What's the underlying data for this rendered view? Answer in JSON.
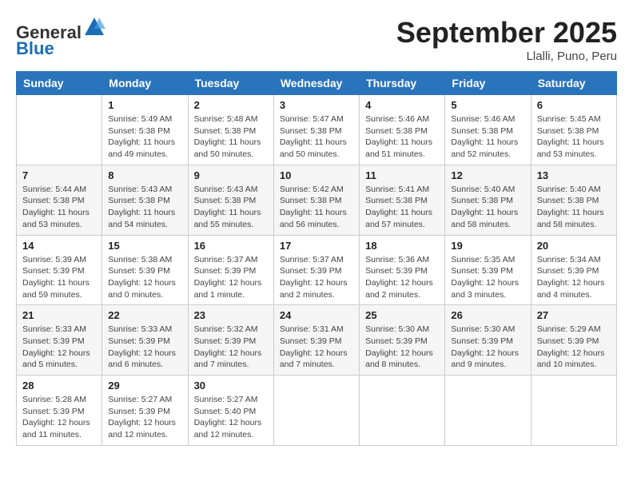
{
  "header": {
    "logo_general": "General",
    "logo_blue": "Blue",
    "month": "September 2025",
    "location": "Llalli, Puno, Peru"
  },
  "days_of_week": [
    "Sunday",
    "Monday",
    "Tuesday",
    "Wednesday",
    "Thursday",
    "Friday",
    "Saturday"
  ],
  "weeks": [
    [
      {
        "day": "",
        "sunrise": "",
        "sunset": "",
        "daylight": ""
      },
      {
        "day": "1",
        "sunrise": "Sunrise: 5:49 AM",
        "sunset": "Sunset: 5:38 PM",
        "daylight": "Daylight: 11 hours and 49 minutes."
      },
      {
        "day": "2",
        "sunrise": "Sunrise: 5:48 AM",
        "sunset": "Sunset: 5:38 PM",
        "daylight": "Daylight: 11 hours and 50 minutes."
      },
      {
        "day": "3",
        "sunrise": "Sunrise: 5:47 AM",
        "sunset": "Sunset: 5:38 PM",
        "daylight": "Daylight: 11 hours and 50 minutes."
      },
      {
        "day": "4",
        "sunrise": "Sunrise: 5:46 AM",
        "sunset": "Sunset: 5:38 PM",
        "daylight": "Daylight: 11 hours and 51 minutes."
      },
      {
        "day": "5",
        "sunrise": "Sunrise: 5:46 AM",
        "sunset": "Sunset: 5:38 PM",
        "daylight": "Daylight: 11 hours and 52 minutes."
      },
      {
        "day": "6",
        "sunrise": "Sunrise: 5:45 AM",
        "sunset": "Sunset: 5:38 PM",
        "daylight": "Daylight: 11 hours and 53 minutes."
      }
    ],
    [
      {
        "day": "7",
        "sunrise": "Sunrise: 5:44 AM",
        "sunset": "Sunset: 5:38 PM",
        "daylight": "Daylight: 11 hours and 53 minutes."
      },
      {
        "day": "8",
        "sunrise": "Sunrise: 5:43 AM",
        "sunset": "Sunset: 5:38 PM",
        "daylight": "Daylight: 11 hours and 54 minutes."
      },
      {
        "day": "9",
        "sunrise": "Sunrise: 5:43 AM",
        "sunset": "Sunset: 5:38 PM",
        "daylight": "Daylight: 11 hours and 55 minutes."
      },
      {
        "day": "10",
        "sunrise": "Sunrise: 5:42 AM",
        "sunset": "Sunset: 5:38 PM",
        "daylight": "Daylight: 11 hours and 56 minutes."
      },
      {
        "day": "11",
        "sunrise": "Sunrise: 5:41 AM",
        "sunset": "Sunset: 5:38 PM",
        "daylight": "Daylight: 11 hours and 57 minutes."
      },
      {
        "day": "12",
        "sunrise": "Sunrise: 5:40 AM",
        "sunset": "Sunset: 5:38 PM",
        "daylight": "Daylight: 11 hours and 58 minutes."
      },
      {
        "day": "13",
        "sunrise": "Sunrise: 5:40 AM",
        "sunset": "Sunset: 5:38 PM",
        "daylight": "Daylight: 11 hours and 58 minutes."
      }
    ],
    [
      {
        "day": "14",
        "sunrise": "Sunrise: 5:39 AM",
        "sunset": "Sunset: 5:39 PM",
        "daylight": "Daylight: 11 hours and 59 minutes."
      },
      {
        "day": "15",
        "sunrise": "Sunrise: 5:38 AM",
        "sunset": "Sunset: 5:39 PM",
        "daylight": "Daylight: 12 hours and 0 minutes."
      },
      {
        "day": "16",
        "sunrise": "Sunrise: 5:37 AM",
        "sunset": "Sunset: 5:39 PM",
        "daylight": "Daylight: 12 hours and 1 minute."
      },
      {
        "day": "17",
        "sunrise": "Sunrise: 5:37 AM",
        "sunset": "Sunset: 5:39 PM",
        "daylight": "Daylight: 12 hours and 2 minutes."
      },
      {
        "day": "18",
        "sunrise": "Sunrise: 5:36 AM",
        "sunset": "Sunset: 5:39 PM",
        "daylight": "Daylight: 12 hours and 2 minutes."
      },
      {
        "day": "19",
        "sunrise": "Sunrise: 5:35 AM",
        "sunset": "Sunset: 5:39 PM",
        "daylight": "Daylight: 12 hours and 3 minutes."
      },
      {
        "day": "20",
        "sunrise": "Sunrise: 5:34 AM",
        "sunset": "Sunset: 5:39 PM",
        "daylight": "Daylight: 12 hours and 4 minutes."
      }
    ],
    [
      {
        "day": "21",
        "sunrise": "Sunrise: 5:33 AM",
        "sunset": "Sunset: 5:39 PM",
        "daylight": "Daylight: 12 hours and 5 minutes."
      },
      {
        "day": "22",
        "sunrise": "Sunrise: 5:33 AM",
        "sunset": "Sunset: 5:39 PM",
        "daylight": "Daylight: 12 hours and 6 minutes."
      },
      {
        "day": "23",
        "sunrise": "Sunrise: 5:32 AM",
        "sunset": "Sunset: 5:39 PM",
        "daylight": "Daylight: 12 hours and 7 minutes."
      },
      {
        "day": "24",
        "sunrise": "Sunrise: 5:31 AM",
        "sunset": "Sunset: 5:39 PM",
        "daylight": "Daylight: 12 hours and 7 minutes."
      },
      {
        "day": "25",
        "sunrise": "Sunrise: 5:30 AM",
        "sunset": "Sunset: 5:39 PM",
        "daylight": "Daylight: 12 hours and 8 minutes."
      },
      {
        "day": "26",
        "sunrise": "Sunrise: 5:30 AM",
        "sunset": "Sunset: 5:39 PM",
        "daylight": "Daylight: 12 hours and 9 minutes."
      },
      {
        "day": "27",
        "sunrise": "Sunrise: 5:29 AM",
        "sunset": "Sunset: 5:39 PM",
        "daylight": "Daylight: 12 hours and 10 minutes."
      }
    ],
    [
      {
        "day": "28",
        "sunrise": "Sunrise: 5:28 AM",
        "sunset": "Sunset: 5:39 PM",
        "daylight": "Daylight: 12 hours and 11 minutes."
      },
      {
        "day": "29",
        "sunrise": "Sunrise: 5:27 AM",
        "sunset": "Sunset: 5:39 PM",
        "daylight": "Daylight: 12 hours and 12 minutes."
      },
      {
        "day": "30",
        "sunrise": "Sunrise: 5:27 AM",
        "sunset": "Sunset: 5:40 PM",
        "daylight": "Daylight: 12 hours and 12 minutes."
      },
      {
        "day": "",
        "sunrise": "",
        "sunset": "",
        "daylight": ""
      },
      {
        "day": "",
        "sunrise": "",
        "sunset": "",
        "daylight": ""
      },
      {
        "day": "",
        "sunrise": "",
        "sunset": "",
        "daylight": ""
      },
      {
        "day": "",
        "sunrise": "",
        "sunset": "",
        "daylight": ""
      }
    ]
  ]
}
